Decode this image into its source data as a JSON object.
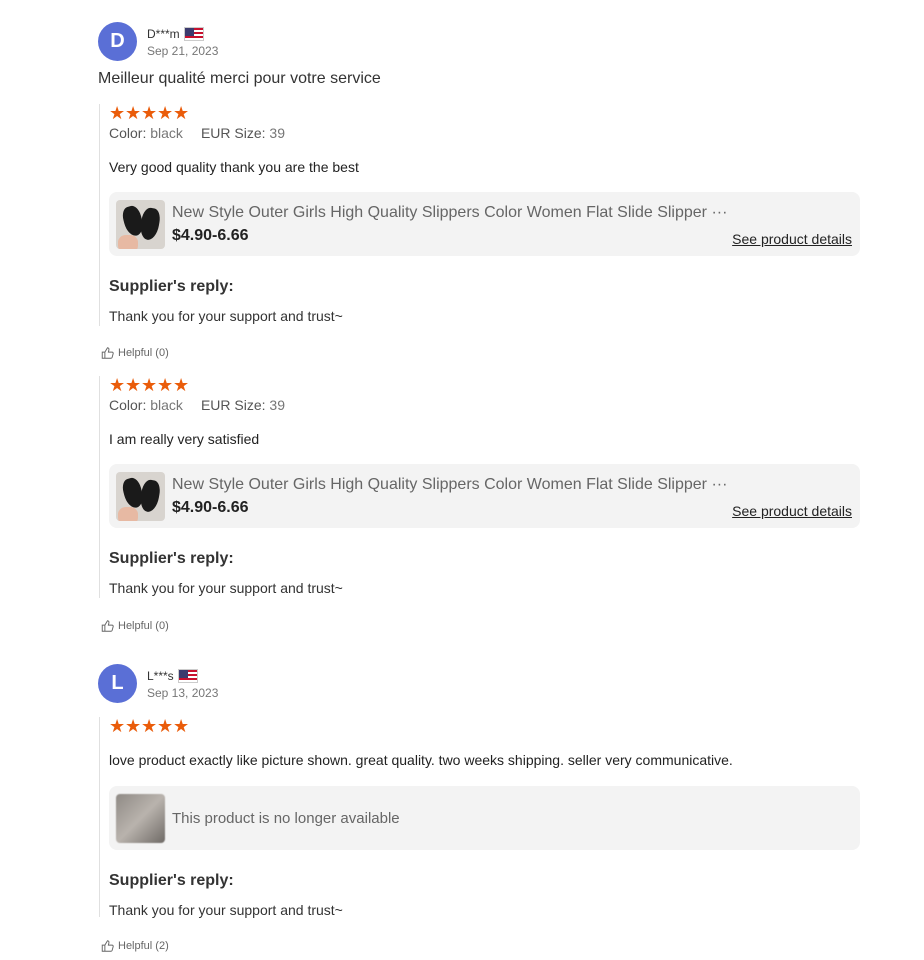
{
  "reviews": [
    {
      "avatar_letter": "D",
      "name": "D***m",
      "date": "Sep 21, 2023",
      "headline": "Meilleur qualité merci pour votre service",
      "stars": 5,
      "color_label": "Color:",
      "color_value": "black",
      "size_label": "EUR Size:",
      "size_value": "39",
      "text": "Very good quality thank you are the best",
      "product_title": "New Style Outer Girls High Quality Slippers Color Women Flat Slide Slipper ···",
      "product_price": "$4.90-6.66",
      "see_details": "See product details",
      "reply_title": "Supplier's reply:",
      "reply_text": "Thank you for your support and trust~",
      "helpful": "Helpful (0)"
    },
    {
      "stars": 5,
      "color_label": "Color:",
      "color_value": "black",
      "size_label": "EUR Size:",
      "size_value": "39",
      "text": "I am really very satisfied",
      "product_title": "New Style Outer Girls High Quality Slippers Color Women Flat Slide Slipper ···",
      "product_price": "$4.90-6.66",
      "see_details": "See product details",
      "reply_title": "Supplier's reply:",
      "reply_text": "Thank you for your support and trust~",
      "helpful": "Helpful (0)"
    },
    {
      "avatar_letter": "L",
      "name": "L***s",
      "date": "Sep 13, 2023",
      "stars": 5,
      "text": "love product exactly like picture shown. great quality. two weeks shipping. seller very communicative.",
      "product_unavailable": "This product is no longer available",
      "reply_title": "Supplier's reply:",
      "reply_text": "Thank you for your support and trust~",
      "helpful": "Helpful (2)"
    }
  ],
  "colors": {
    "star": "#ea5c0a",
    "avatar": "#5a6fd6",
    "card_bg": "#f3f3f3"
  },
  "icons": {
    "star": "star-icon",
    "flag": "us-flag-icon",
    "helpful": "thumbs-up-icon"
  }
}
